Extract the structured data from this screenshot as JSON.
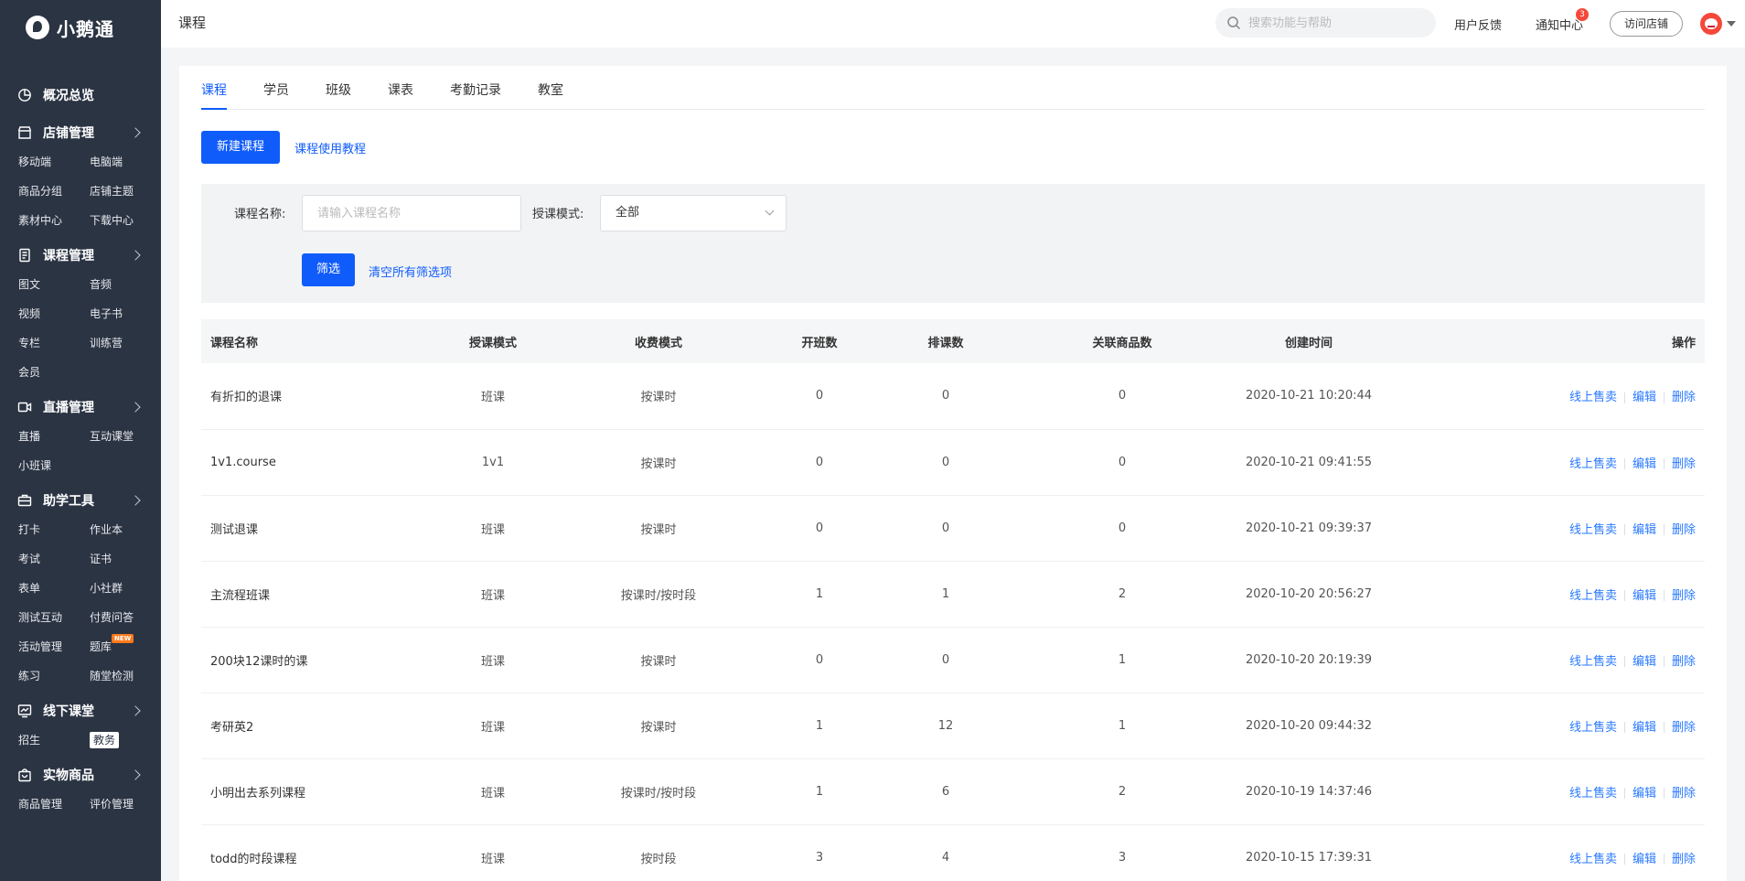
{
  "brand": {
    "name": "小鹅通"
  },
  "sidebar": {
    "overview": "概况总览",
    "groups": [
      {
        "title": "店铺管理",
        "items": [
          "移动端",
          "电脑端",
          "商品分组",
          "店铺主题",
          "素材中心",
          "下载中心"
        ]
      },
      {
        "title": "课程管理",
        "items": [
          "图文",
          "音频",
          "视频",
          "电子书",
          "专栏",
          "训练营",
          "会员"
        ]
      },
      {
        "title": "直播管理",
        "items": [
          "直播",
          "互动课堂",
          "小班课"
        ]
      },
      {
        "title": "助学工具",
        "items": [
          "打卡",
          "作业本",
          "考试",
          "证书",
          "表单",
          "小社群",
          "测试互动",
          "付费问答",
          "活动管理",
          "题库",
          "练习",
          "随堂检测"
        ],
        "new_badge": "NEW"
      },
      {
        "title": "线下课堂",
        "items": [
          "招生",
          "教务"
        ],
        "active": "教务"
      },
      {
        "title": "实物商品",
        "items": [
          "商品管理",
          "评价管理"
        ]
      }
    ]
  },
  "header": {
    "title": "课程",
    "search_placeholder": "搜索功能与帮助",
    "feedback": "用户反馈",
    "notify": "通知中心",
    "notify_count": "3",
    "visit_store": "访问店铺"
  },
  "tabs": [
    "课程",
    "学员",
    "班级",
    "课表",
    "考勤记录",
    "教室"
  ],
  "actions": {
    "new_course": "新建课程",
    "tutorial": "课程使用教程"
  },
  "filter": {
    "name_label": "课程名称:",
    "name_placeholder": "请输入课程名称",
    "mode_label": "授课模式:",
    "mode_value": "全部",
    "submit": "筛选",
    "clear": "清空所有筛选项"
  },
  "table": {
    "columns": [
      "课程名称",
      "授课模式",
      "收费模式",
      "开班数",
      "排课数",
      "关联商品数",
      "创建时间",
      "操作"
    ],
    "op_labels": {
      "sell": "线上售卖",
      "edit": "编辑",
      "delete": "删除"
    },
    "rows": [
      [
        "有折扣的退课",
        "班课",
        "按课时",
        "0",
        "0",
        "0",
        "2020-10-21 10:20:44"
      ],
      [
        "1v1.course",
        "1v1",
        "按课时",
        "0",
        "0",
        "0",
        "2020-10-21 09:41:55"
      ],
      [
        "测试退课",
        "班课",
        "按课时",
        "0",
        "0",
        "0",
        "2020-10-21 09:39:37"
      ],
      [
        "主流程班课",
        "班课",
        "按课时/按时段",
        "1",
        "1",
        "2",
        "2020-10-20 20:56:27"
      ],
      [
        "200块12课时的课",
        "班课",
        "按课时",
        "0",
        "0",
        "1",
        "2020-10-20 20:19:39"
      ],
      [
        "考研英2",
        "班课",
        "按课时",
        "1",
        "12",
        "1",
        "2020-10-20 09:44:32"
      ],
      [
        "小明出去系列课程",
        "班课",
        "按课时/按时段",
        "1",
        "6",
        "2",
        "2020-10-19 14:37:46"
      ],
      [
        "todd的时段课程",
        "班课",
        "按时段",
        "3",
        "4",
        "3",
        "2020-10-15 17:39:31"
      ]
    ]
  },
  "colors": {
    "primary": "#105cfb",
    "sidebar_bg": "#2b3443",
    "link": "#2979ff"
  }
}
